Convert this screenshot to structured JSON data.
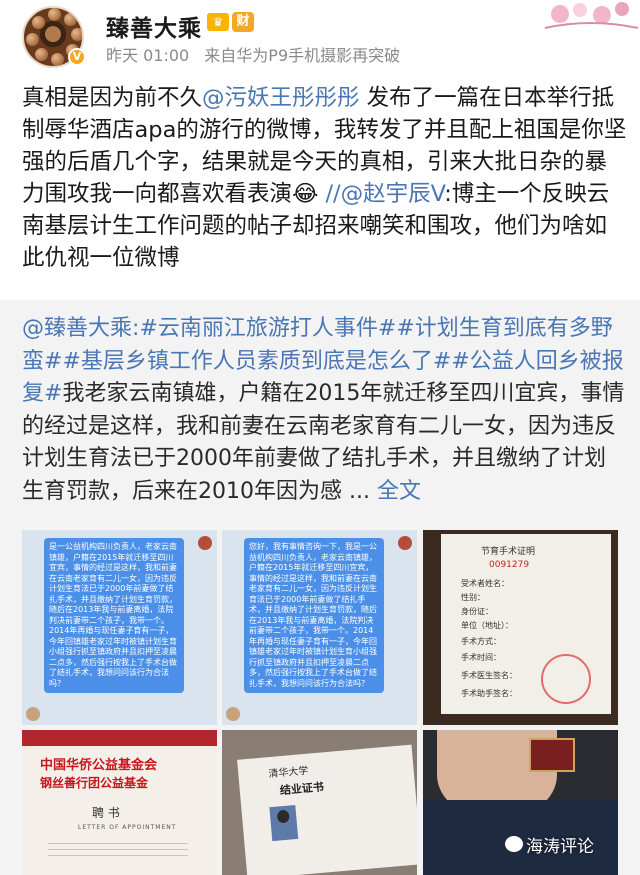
{
  "user": {
    "name": "臻善大乘",
    "verified_mark": "V",
    "crown_badge": "♛",
    "cai_badge": "财",
    "time": "昨天 01:00",
    "source": "来自华为P9手机摄影再突破"
  },
  "post": {
    "text_a": "真相是因为前不久",
    "mention_1": "@污妖王彤彤彤",
    "text_b": " 发布了一篇在日本举行抵制辱华酒店apa的游行的微博，我转发了并且配上祖国是你坚强的后盾几个字，结果就是今天的真相，引来大批日杂的暴力围攻我一向都喜欢看表演",
    "emoji": "😂",
    "text_c": " //",
    "mention_2": "@赵宇辰V",
    "text_d": ":博主一个反映云南基层计生工作问题的帖子却招来嘲笑和围攻，他们为啥如此仇视一位微博"
  },
  "repost": {
    "author": "@臻善大乘",
    "colon": ":",
    "tag_1": "#云南丽江旅游打人事件#",
    "tag_2": "#计划生育到底有多野蛮#",
    "tag_3": "#基层乡镇工作人员素质到底是怎么了#",
    "tag_4": "#公益人回乡被报复#",
    "body": "我老家云南镇雄，户籍在2015年就迁移至四川宜宾，事情的经过是这样，我和前妻在云南老家育有二儿一女，因为违反计划生育法已于2000年前妻做了结扎手术，并且缴纳了计划生育罚款，后来在2010年因为感 ...",
    "full_text": "全文"
  },
  "images": {
    "chat_1": "是一公益机构四川负责人，老家云南镇雄，户籍在2015年就迁移至四川宜宾，事情的经过是这样，我和前妻在云南老家育有二儿一女，因为违反计划生育法已于2000年前妻做了结扎手术，并且缴纳了计划生育罚款，随后在2013年我与前妻离婚，法院判决前妻带二个孩子，我带一个。2014年再婚与现任妻子育有一子，今年回镇雄老家过年时被镇计划生育小组强行抓至镇政府并且扣押至凌晨二点多，然后强行按我上了手术台做了结扎手术，我想问问该行为合法吗？",
    "chat_2": "您好，我有事情咨询一下，我是一公益机构四川负责人，老家云南镇雄，户籍在2015年就迁移至四川宜宾，事情的经过是这样，我和前妻在云南老家育有二儿一女，因为违反计划生育法已于2000年前妻做了结扎手术，并且缴纳了计划生育罚款，随后在2013年我与前妻离婚，法院判决前妻带二个孩子，我带一个。2014年再婚与现任妻子育有一子，今年回镇雄老家过年时被镇计划生育小组强行抓至镇政府并且扣押至凌晨二点多，然后强行按我上了手术台做了结扎手术，我想问问该行为合法吗？",
    "surgery_title": "节育手术证明",
    "surgery_number": "0091279",
    "surgery_name": "受术者姓名：",
    "surgery_gender": "性别：",
    "surgery_id": "身份证：",
    "surgery_unit": "单位（地址）：",
    "surgery_method": "手术方式：",
    "surgery_time": "手术时间：",
    "surgery_doctor": "手术医生签名：",
    "surgery_assist": "手术助手签名：",
    "cert_red_org": "中国华侨公益基金会",
    "cert_red_fund": "钢丝善行团公益基金",
    "cert_red_title": "聘 书",
    "cert_red_sub": "LETTER OF APPOINTMENT",
    "grad_school": "清华大学",
    "grad_title": "结业证书"
  },
  "watermark": "海涛评论"
}
